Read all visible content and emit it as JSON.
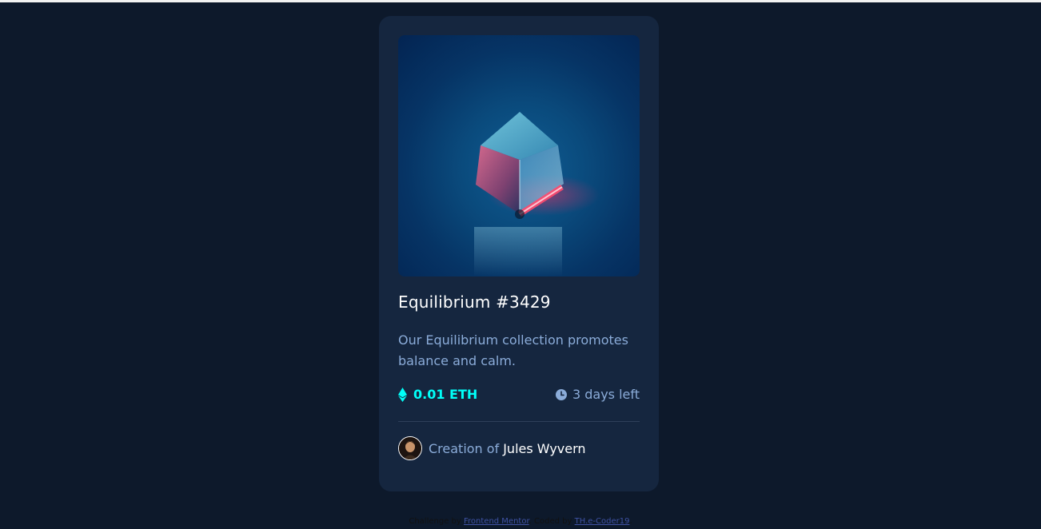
{
  "card": {
    "image_alt": "Equilibrium",
    "title": "Equilibrium #3429",
    "description": "Our Equilibrium collection promotes balance and calm.",
    "price": "0.01 ETH",
    "time_left": "3 days left",
    "creator_prefix": "Creation of",
    "creator_name": "Jules Wyvern"
  },
  "icons": {
    "price": "ethereum-icon",
    "time": "clock-icon",
    "avatar": "avatar"
  },
  "colors": {
    "background": "#0d192b",
    "card": "#15263f",
    "cyan": "#00fff8",
    "soft_blue": "#8bacd9",
    "white": "#ffffff"
  },
  "footer": {
    "challenge_prefix": "Challenge by",
    "challenge_link": "Frontend Mentor",
    "coded_prefix": "Coded by",
    "coded_link": "TH.e-Coder19"
  }
}
